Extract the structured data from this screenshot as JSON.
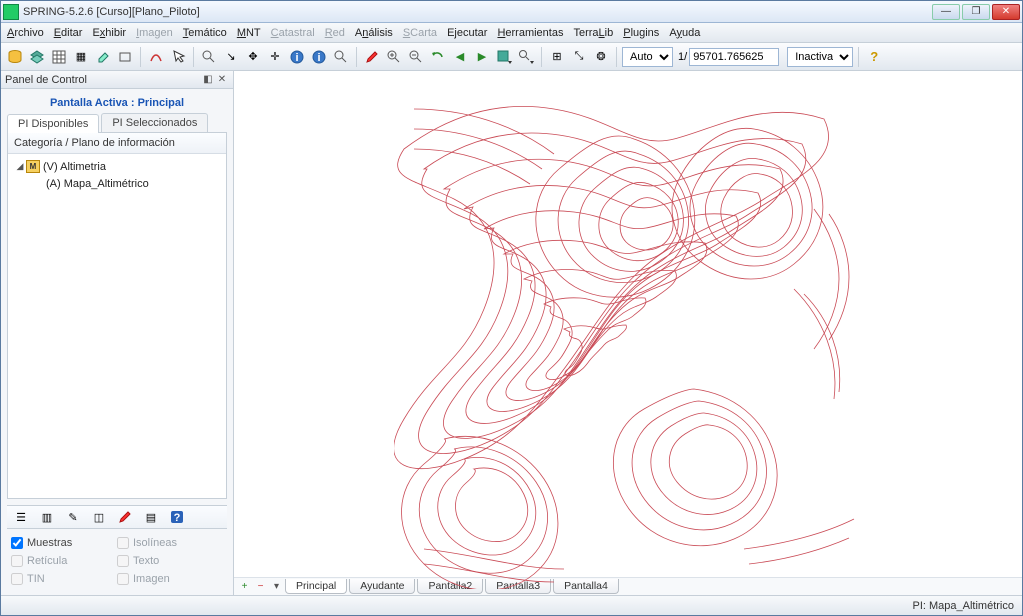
{
  "title": "SPRING-5.2.6 [Curso][Plano_Piloto]",
  "menu": [
    "Archivo",
    "Editar",
    "Exhibir",
    "Imagen",
    "Temático",
    "MNT",
    "Catastral",
    "Red",
    "Análisis",
    "SCarta",
    "Ejecutar",
    "Herramientas",
    "TerraLib",
    "Plugins",
    "Ayuda"
  ],
  "menu_disabled": [
    "Imagen",
    "Catastral",
    "Red",
    "SCarta"
  ],
  "toolbar": {
    "mode_select": "Auto",
    "scale_prefix": "1/",
    "scale_value": "95701.765625",
    "state_select": "Inactiva"
  },
  "panel": {
    "title": "Panel de Control",
    "active_screen_label": "Pantalla Activa : Principal",
    "tabs": [
      "PI Disponibles",
      "PI Seleccionados"
    ],
    "tree_header": "Categoría / Plano de información",
    "tree": {
      "root": "(V) Altimetria",
      "child": "(A) Mapa_Altimétrico"
    },
    "checks": {
      "muestras": "Muestras",
      "isolineas": "Isolíneas",
      "reticula": "Retícula",
      "texto": "Texto",
      "tin": "TIN",
      "imagen": "Imagen"
    }
  },
  "bottom_tabs": [
    "Principal",
    "Ayudante",
    "Pantalla2",
    "Pantalla3",
    "Pantalla4"
  ],
  "status": {
    "right": "PI: Mapa_Altimétrico"
  }
}
